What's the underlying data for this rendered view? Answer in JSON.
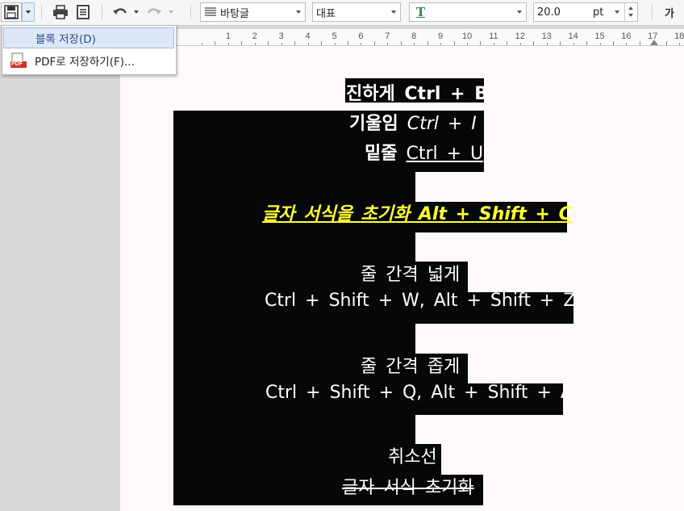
{
  "toolbar": {
    "font_face": "바탕글",
    "style_name": "대표",
    "char_style_icon": "T",
    "font_size": "20.0",
    "size_unit": "pt",
    "char_shape_label": "가"
  },
  "ruler": {
    "numbers": [
      "1",
      "2",
      "3",
      "4",
      "5",
      "6",
      "7",
      "8",
      "9",
      "10",
      "11",
      "12",
      "13",
      "14",
      "15",
      "16",
      "17",
      "18"
    ]
  },
  "save_menu": {
    "items": [
      {
        "label": "블록 저장(D)"
      },
      {
        "label": "PDF로 저장하기(F)..."
      }
    ],
    "pdf_icon_text": "PDF"
  },
  "document": {
    "bold_label": "진하게",
    "bold_keys": "Ctrl + B",
    "italic_label": "기울임",
    "italic_keys": "Ctrl + I",
    "underline_label": "밑줄",
    "underline_keys": "Ctrl + U",
    "reset_format": "글자 서식을 초기화 Alt + Shift + C",
    "widen_label": "줄 간격 넓게",
    "widen_keys": "Ctrl + Shift + W, Alt + Shift + Z",
    "narrow_label": "줄 간격 좁게",
    "narrow_keys": "Ctrl + Shift + Q, Alt + Shift + A",
    "strike_label": "취소선",
    "strike_text": "글자 서식 초기화"
  },
  "colors": {
    "selection": "#050708",
    "highlight_yellow": "#ffff33",
    "page": "#fffaf9"
  }
}
